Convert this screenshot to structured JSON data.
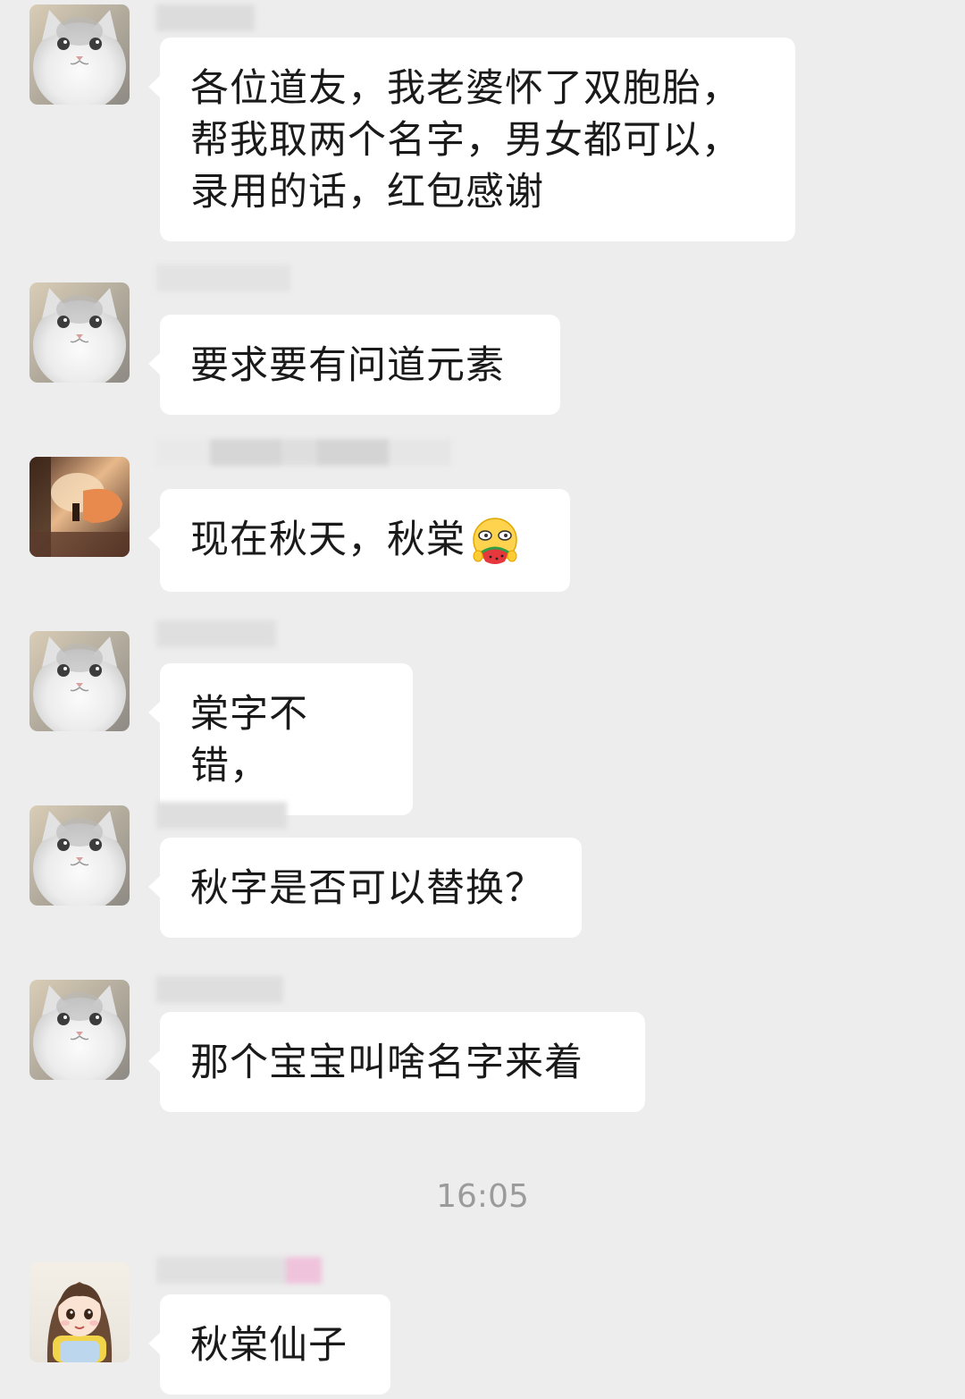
{
  "messages": [
    {
      "id": "m1",
      "text": "各位道友，我老婆怀了双胞胎，帮我取两个名字，男女都可以，录用的话，红包感谢"
    },
    {
      "id": "m2",
      "text": "要求要有问道元素"
    },
    {
      "id": "m3",
      "text": "现在秋天，秋棠",
      "emoji": "grinning-watermelon-emoji"
    },
    {
      "id": "m4",
      "text": "棠字不错，"
    },
    {
      "id": "m5",
      "text": "秋字是否可以替换？"
    },
    {
      "id": "m6",
      "text": "那个宝宝叫啥名字来着"
    },
    {
      "id": "m7",
      "text": "秋棠仙子"
    }
  ],
  "timestamp": "16:05",
  "avatars": {
    "cat": "cat-avatar",
    "landscape": "sunset-hand-avatar",
    "girl": "cartoon-girl-avatar"
  },
  "colors": {
    "background": "#ededed",
    "bubble": "#ffffff",
    "text": "#1a1a1a",
    "timestamp": "#9b9b9b"
  }
}
